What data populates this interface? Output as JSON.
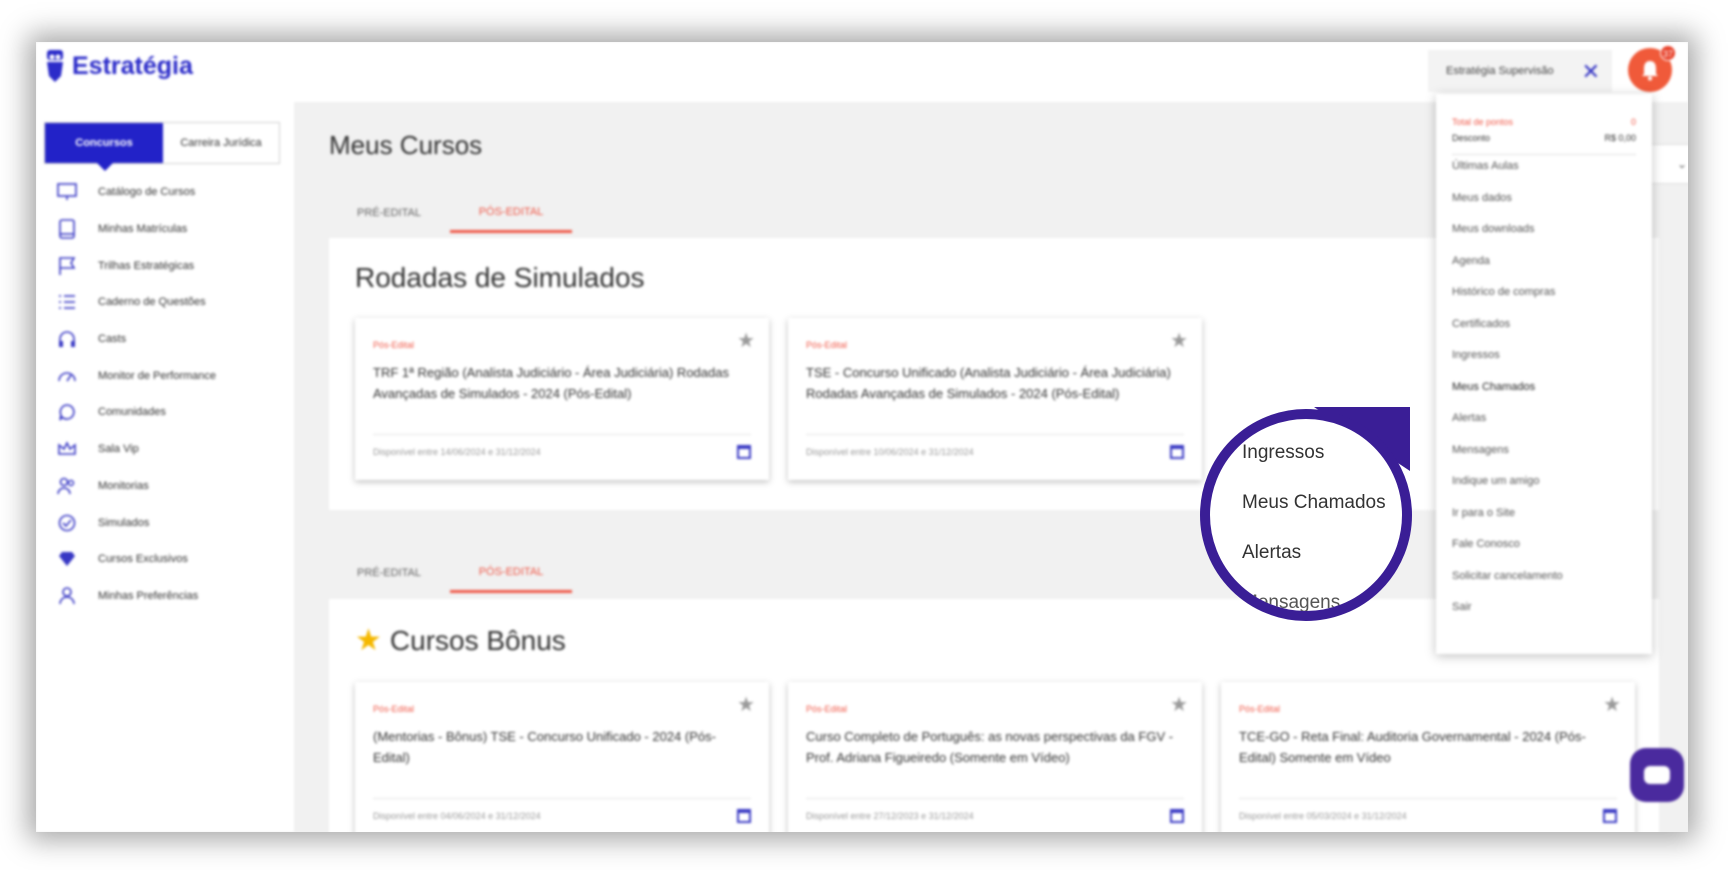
{
  "header": {
    "logo_text": "Estratégia",
    "account_label": "Estratégia Supervisão",
    "notification_count": "37"
  },
  "sidebar": {
    "segments": [
      "Concursos",
      "Carreira Jurídica"
    ],
    "items": [
      {
        "label": "Catálogo de Cursos",
        "icon": "monitor-icon"
      },
      {
        "label": "Minhas Matrículas",
        "icon": "book-icon"
      },
      {
        "label": "Trilhas Estratégicas",
        "icon": "flag-icon"
      },
      {
        "label": "Caderno de Questões",
        "icon": "list-icon"
      },
      {
        "label": "Casts",
        "icon": "headphones-icon"
      },
      {
        "label": "Monitor de Performance",
        "icon": "gauge-icon"
      },
      {
        "label": "Comunidades",
        "icon": "chat-bubble-icon"
      },
      {
        "label": "Sala Vip",
        "icon": "crown-icon"
      },
      {
        "label": "Monitorias",
        "icon": "users-icon"
      },
      {
        "label": "Simulados",
        "icon": "check-circle-icon"
      },
      {
        "label": "Cursos Exclusivos",
        "icon": "diamond-icon"
      },
      {
        "label": "Minhas Preferências",
        "icon": "user-icon"
      }
    ]
  },
  "main": {
    "page_title": "Meus Cursos",
    "sections": [
      {
        "tabs": [
          "PRÉ-EDITAL",
          "PÓS-EDITAL"
        ],
        "title": "Rodadas de Simulados",
        "cards": [
          {
            "tag": "Pós-Edital",
            "title": "TRF 1ª Região (Analista Judiciário - Área Judiciária) Rodadas Avançadas de Simulados - 2024 (Pós-Edital)",
            "availability": "Disponível entre 14/06/2024 e 31/12/2024"
          },
          {
            "tag": "Pós-Edital",
            "title": "TSE - Concurso Unificado (Analista Judiciário - Área Judiciária) Rodadas Avançadas de Simulados - 2024 (Pós-Edital)",
            "availability": "Disponível entre 10/06/2024 e 31/12/2024"
          }
        ]
      },
      {
        "tabs": [
          "PRÉ-EDITAL",
          "PÓS-EDITAL"
        ],
        "title": "Cursos Bônus",
        "cards": [
          {
            "tag": "Pós-Edital",
            "title": "(Mentorias - Bônus) TSE - Concurso Unificado - 2024 (Pós-Edital)",
            "availability": "Disponível entre 04/06/2024 e 31/12/2024"
          },
          {
            "tag": "Pós-Edital",
            "title": "Curso Completo de Português: as novas perspectivas da FGV - Prof. Adriana Figueiredo (Somente em Vídeo)",
            "availability": "Disponível entre 27/12/2023 e 31/12/2024"
          },
          {
            "tag": "Pós-Edital",
            "title": "TCE-GO - Reta Final: Auditoria Governamental - 2024 (Pós-Edital) Somente em Vídeo",
            "availability": "Disponível entre 05/03/2024 e 31/12/2024"
          }
        ]
      }
    ]
  },
  "dropdown": {
    "points_label": "Total de pontos",
    "points_value": "0",
    "discount_label": "Desconto",
    "discount_value": "R$ 0,00",
    "items": [
      "Últimas Aulas",
      "Meus dados",
      "Meus downloads",
      "Agenda",
      "Histórico de compras",
      "Certificados",
      "Ingressos",
      "Meus Chamados",
      "Alertas",
      "Mensagens",
      "Indique um amigo",
      "Ir para o Site",
      "Fale Conosco",
      "Solicitar cancelamento",
      "Sair"
    ],
    "highlighted_item": "Meus Chamados"
  },
  "magnifier": {
    "items": [
      "Ingressos",
      "Meus Chamados",
      "Alertas",
      "Mensagens"
    ]
  },
  "colors": {
    "brand_blue": "#2222c8",
    "accent_red": "#f05a4a",
    "magnifier_border": "#3a1e96"
  }
}
